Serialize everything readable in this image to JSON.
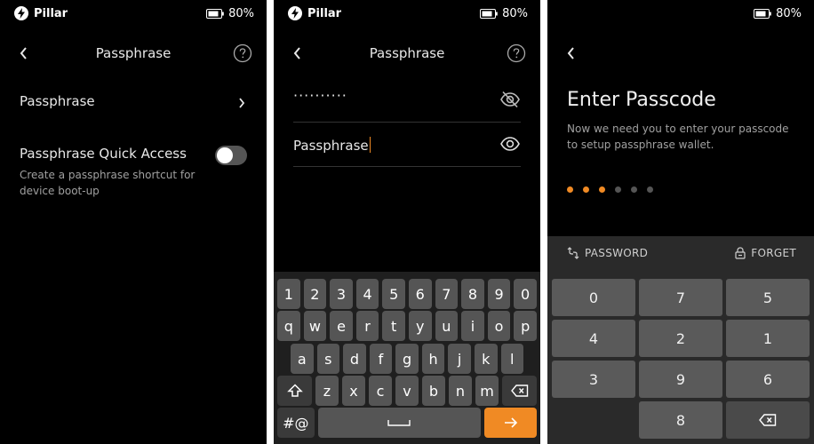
{
  "status": {
    "app_name": "Pillar",
    "battery": "80%"
  },
  "screen1": {
    "title": "Passphrase",
    "items": [
      {
        "label": "Passphrase"
      },
      {
        "label": "Passphrase Quick Access",
        "description": "Create a passphrase shortcut for device boot-up",
        "toggle_on": false
      }
    ]
  },
  "screen2": {
    "title": "Passphrase",
    "masked_value": "··········",
    "input_value": "Passphrase",
    "keyboard": {
      "row1": [
        "1",
        "2",
        "3",
        "4",
        "5",
        "6",
        "7",
        "8",
        "9",
        "0"
      ],
      "row2": [
        "q",
        "w",
        "e",
        "r",
        "t",
        "y",
        "u",
        "i",
        "o",
        "p"
      ],
      "row3": [
        "a",
        "s",
        "d",
        "f",
        "g",
        "h",
        "j",
        "k",
        "l"
      ],
      "row4": [
        "z",
        "x",
        "c",
        "v",
        "b",
        "n",
        "m"
      ],
      "symbols_label": "#@"
    }
  },
  "screen3": {
    "title": "Enter Passcode",
    "description": "Now we need you to enter your passcode to setup passphrase wallet.",
    "entered_digits": 3,
    "total_digits": 6,
    "password_label": "PASSWORD",
    "forget_label": "FORGET",
    "numpad": [
      "0",
      "7",
      "5",
      "4",
      "2",
      "1",
      "3",
      "9",
      "6",
      "8"
    ]
  },
  "colors": {
    "accent": "#f08a24",
    "background": "#000000",
    "key": "#555555"
  }
}
